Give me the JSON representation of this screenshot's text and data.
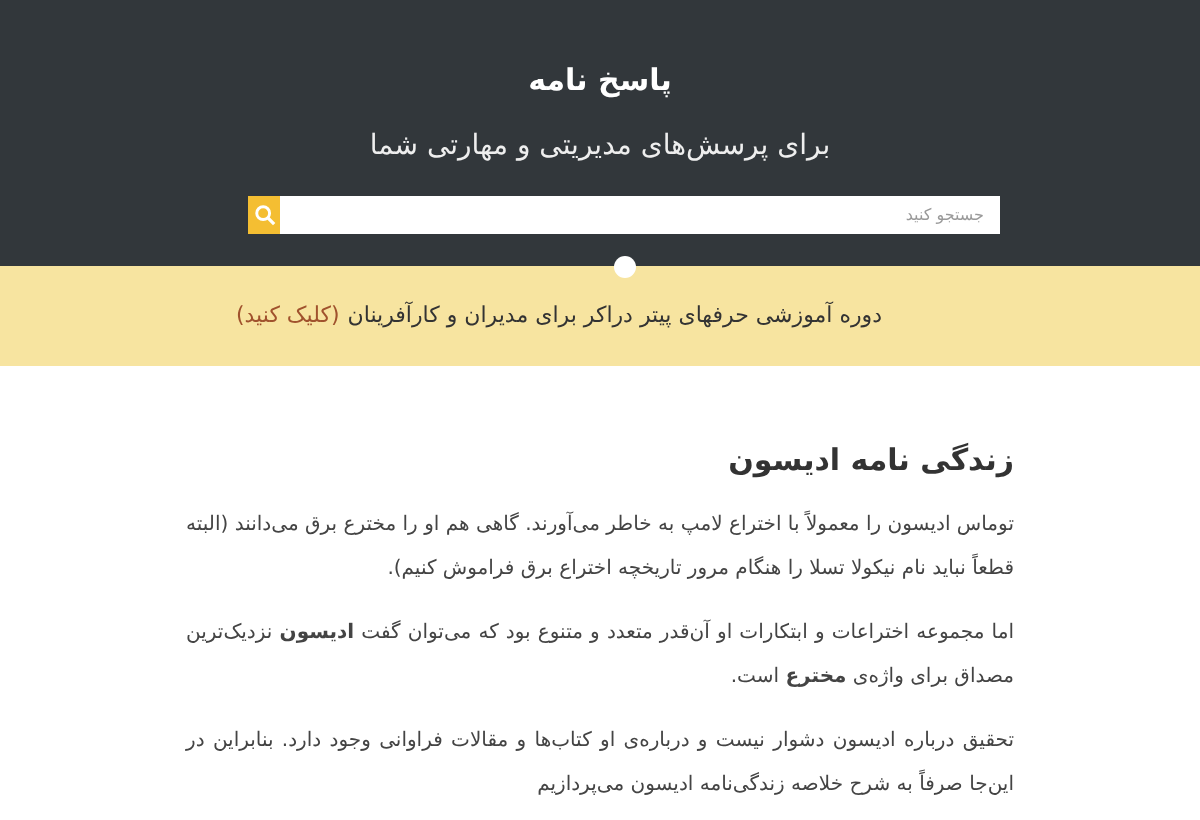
{
  "header": {
    "title": "پاسخ نامه",
    "subtitle": "برای پرسش‌های مدیریتی و مهارتی شما",
    "search": {
      "placeholder": "جستجو کنید"
    }
  },
  "banner": {
    "text": "دوره آموزشی حرفهای پیتر دراکر برای مدیران و کارآفرینان",
    "link": "(کلیک کنید)"
  },
  "article": {
    "title": "زندگی نامه ادیسون",
    "paragraphs": [
      "توماس ادیسون را معمولاً با اختراع لامپ به خاطر می‌آورند. گاهی هم او را مخترع برق می‌دانند (البته قطعاً نباید نام نیکولا تسلا را هنگام مرور تاریخچه اختراع برق فراموش کنیم).",
      "اما مجموعه اختراعات و ابتکارات او آن‌قدر متعدد و متنوع بود که می‌توان گفت **ادیسون** نزدیک‌ترین مصداق برای واژه‌ی **مخترع** است.",
      "تحقیق درباره ادیسون دشوار نیست و درباره‌ی او کتاب‌ها و مقالات فراوانی وجود دارد. بنابراین در این‌جا صرفاً به شرح خلاصه زندگی‌نامه ادیسون می‌پردازیم"
    ]
  }
}
